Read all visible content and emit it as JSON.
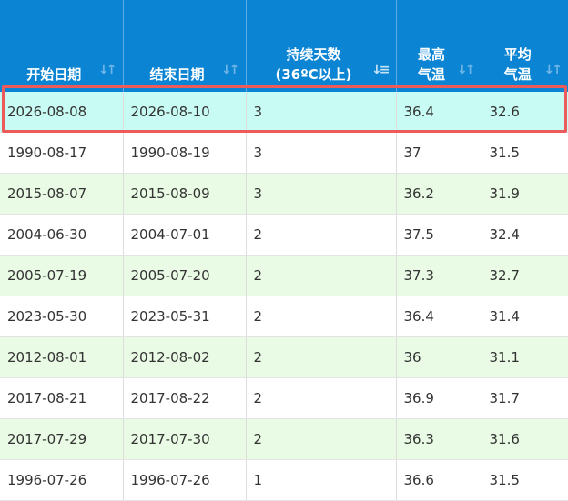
{
  "table": {
    "headers": {
      "start_date": "开始日期",
      "end_date": "结束日期",
      "duration_line1": "持续天数",
      "duration_line2": "(36ºC以上)",
      "max_temp_line1": "最高",
      "max_temp_line2": "气温",
      "avg_temp_line1": "平均",
      "avg_temp_line2": "气温"
    },
    "sort_icons": {
      "inactive": "sort-updown-icon",
      "active": "sort-descending-icon"
    },
    "rows": [
      {
        "start": "2026-08-08",
        "end": "2026-08-10",
        "days": "3",
        "max": "36.4",
        "avg": "32.6"
      },
      {
        "start": "1990-08-17",
        "end": "1990-08-19",
        "days": "3",
        "max": "37",
        "avg": "31.5"
      },
      {
        "start": "2015-08-07",
        "end": "2015-08-09",
        "days": "3",
        "max": "36.2",
        "avg": "31.9"
      },
      {
        "start": "2004-06-30",
        "end": "2004-07-01",
        "days": "2",
        "max": "37.5",
        "avg": "32.4"
      },
      {
        "start": "2005-07-19",
        "end": "2005-07-20",
        "days": "2",
        "max": "37.3",
        "avg": "32.7"
      },
      {
        "start": "2023-05-30",
        "end": "2023-05-31",
        "days": "2",
        "max": "36.4",
        "avg": "31.4"
      },
      {
        "start": "2012-08-01",
        "end": "2012-08-02",
        "days": "2",
        "max": "36",
        "avg": "31.1"
      },
      {
        "start": "2017-08-21",
        "end": "2017-08-22",
        "days": "2",
        "max": "36.9",
        "avg": "31.7"
      },
      {
        "start": "2017-07-29",
        "end": "2017-07-30",
        "days": "2",
        "max": "36.3",
        "avg": "31.6"
      },
      {
        "start": "1996-07-26",
        "end": "1996-07-26",
        "days": "1",
        "max": "36.6",
        "avg": "31.5"
      }
    ]
  },
  "colors": {
    "header_bg": "#0b85d3",
    "row_alt_bg": "#e9fbe4",
    "highlight_bg": "#c8fbf3",
    "highlight_border": "#ec5a5a"
  }
}
